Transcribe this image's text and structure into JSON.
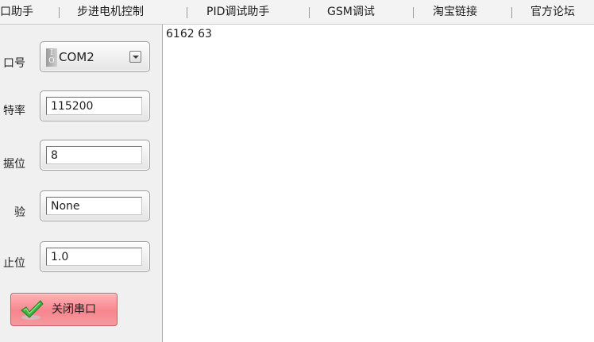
{
  "tabs": [
    {
      "label": "口助手"
    },
    {
      "label": "步进电机控制"
    },
    {
      "label": "PID调试助手"
    },
    {
      "label": "GSM调试"
    },
    {
      "label": "淘宝链接"
    },
    {
      "label": "官方论坛"
    }
  ],
  "serial_settings": {
    "port_label": "口号",
    "port_io_icon_top": "I",
    "port_io_icon_bottom": "O",
    "port_value": "COM2",
    "baud_label": "特率",
    "baud_value": "115200",
    "data_bits_label": "据位",
    "data_bits_value": "8",
    "parity_label": "验",
    "parity_value": "None",
    "stop_bits_label": "止位",
    "stop_bits_value": "1.0",
    "close_button_label": "关闭串口"
  },
  "receive": {
    "text": "6162 63"
  },
  "colors": {
    "close_button": "#f7858d",
    "check_icon": "#3cb43c"
  },
  "icons": {
    "port_prefix": "io-icon",
    "dropdown": "chevron-down-icon",
    "close_button": "check-icon"
  }
}
